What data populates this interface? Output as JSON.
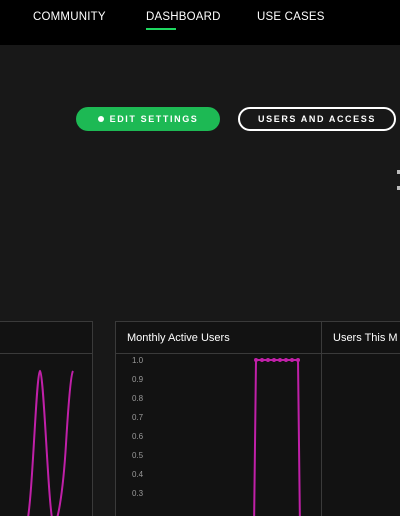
{
  "nav": {
    "items": [
      {
        "label": "COMMUNITY"
      },
      {
        "label": "DASHBOARD",
        "active": true
      },
      {
        "label": "USE CASES"
      }
    ],
    "accent_color": "#1ed760"
  },
  "actions": {
    "edit_settings": "EDIT SETTINGS",
    "users_and_access": "USERS AND ACCESS"
  },
  "panels": {
    "left": {
      "title": ""
    },
    "monthly_active_users": {
      "title": "Monthly Active Users"
    },
    "users_this_month": {
      "title": "Users This M"
    }
  },
  "chart_data": [
    {
      "type": "line",
      "title": "Monthly Active Users",
      "ylim": [
        0.3,
        1.0
      ],
      "y_ticks": [
        "1.0",
        "0.9",
        "0.8",
        "0.7",
        "0.6",
        "0.5",
        "0.4",
        "0.3"
      ],
      "series": [
        {
          "color": "#c020a8",
          "points": [
            [
              0,
              0.0
            ],
            [
              1,
              1.0
            ],
            [
              2,
              1.0
            ],
            [
              3,
              1.0
            ],
            [
              4,
              1.0
            ],
            [
              5,
              1.0
            ],
            [
              6,
              1.0
            ],
            [
              7,
              1.0
            ],
            [
              8,
              1.0
            ],
            [
              9,
              0.0
            ]
          ]
        }
      ]
    }
  ]
}
